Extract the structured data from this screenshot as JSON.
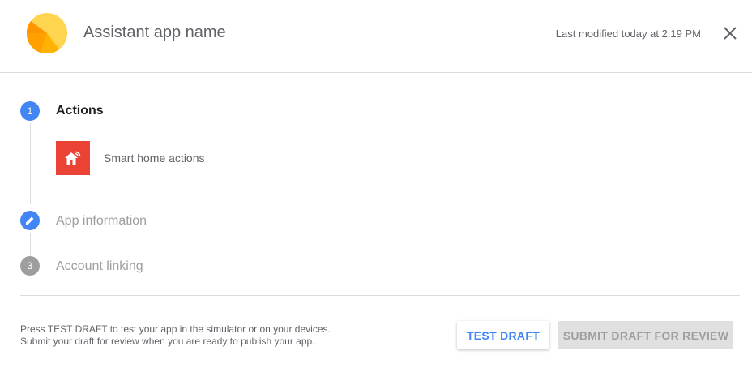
{
  "header": {
    "app_name": "Assistant app name",
    "last_modified": "Last modified today at 2:19 PM"
  },
  "steps": [
    {
      "number": "1",
      "label": "Actions",
      "state": "active"
    },
    {
      "number": "",
      "label": "App information",
      "state": "edit",
      "icon": "pencil-icon"
    },
    {
      "number": "3",
      "label": "Account linking",
      "state": "inactive"
    }
  ],
  "actions": [
    {
      "label": "Smart home actions",
      "icon": "smart-home-icon"
    }
  ],
  "footer": {
    "hint_line_1": "Press TEST DRAFT to test your app in the simulator or on your devices.",
    "hint_line_2": "Submit your draft for review when you are ready to publish your app.",
    "test_button": "TEST DRAFT",
    "submit_button": "SUBMIT DRAFT FOR REVIEW"
  },
  "colors": {
    "accent": "#4285f4",
    "action_icon_bg": "#ea4335",
    "disabled_step": "#9e9e9e"
  }
}
